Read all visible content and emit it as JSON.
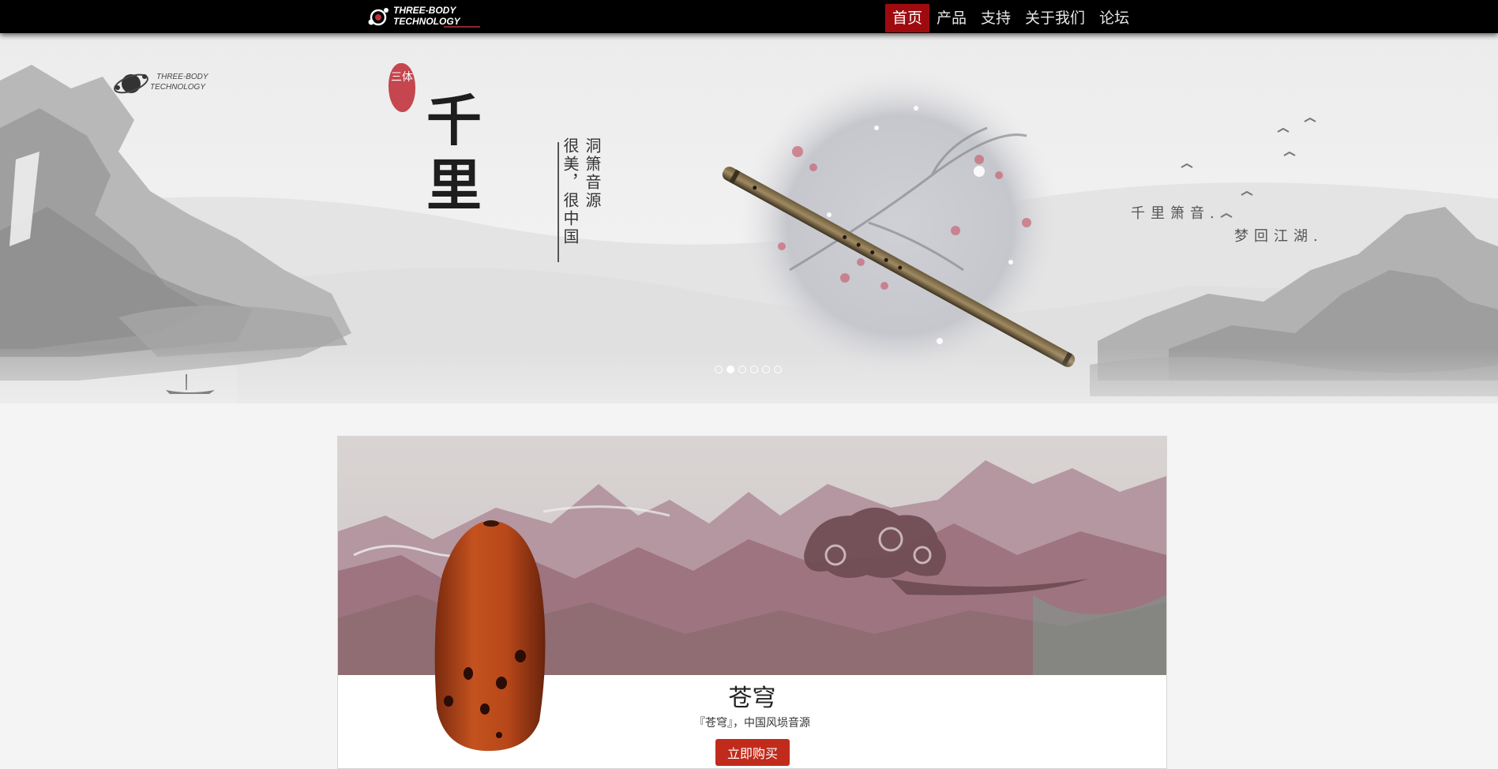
{
  "brand": {
    "line1": "THREE-BODY",
    "line2": "TECHNOLOGY"
  },
  "nav": [
    {
      "label": "首页",
      "active": true
    },
    {
      "label": "产品",
      "active": false
    },
    {
      "label": "支持",
      "active": false
    },
    {
      "label": "关于我们",
      "active": false
    },
    {
      "label": "论坛",
      "active": false
    }
  ],
  "banner": {
    "seal": "三体",
    "title": [
      "千",
      "里"
    ],
    "vertical_right": "洞箫音源",
    "vertical_left": "很美，很中国",
    "slogan_line1": "千里箫音.",
    "slogan_line2": "梦回江湖.",
    "carousel": {
      "count": 6,
      "active_index": 1
    }
  },
  "product": {
    "name": "苍穹",
    "description": "『苍穹』，中国风埙音源",
    "buy_label": "立即购买"
  },
  "colors": {
    "accent": "#9e0b0f",
    "button": "#c02b1c",
    "nav_bg": "#000000"
  }
}
